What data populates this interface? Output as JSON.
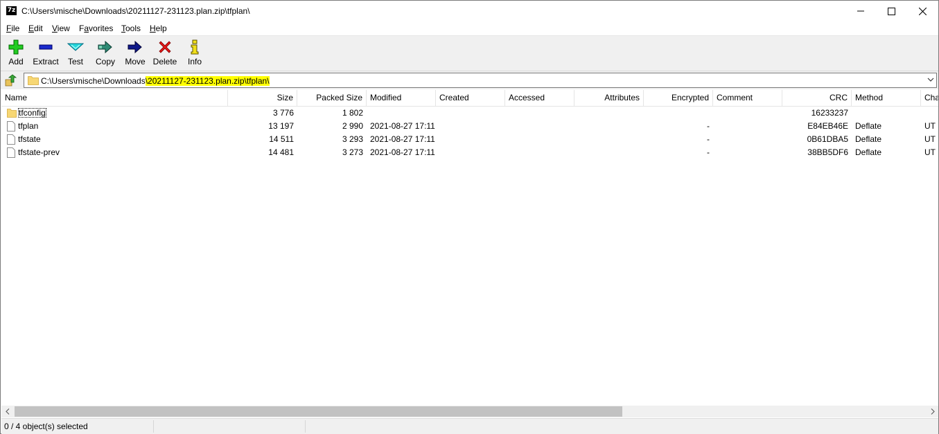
{
  "window": {
    "title": "C:\\Users\\mische\\Downloads\\20211127-231123.plan.zip\\tfplan\\",
    "app_icon_text": "7z"
  },
  "menu": [
    {
      "underline": "F",
      "rest": "ile"
    },
    {
      "underline": "E",
      "rest": "dit"
    },
    {
      "underline": "V",
      "rest": "iew"
    },
    {
      "pre": "F",
      "underline": "a",
      "rest": "vorites"
    },
    {
      "underline": "T",
      "rest": "ools"
    },
    {
      "underline": "H",
      "rest": "elp"
    }
  ],
  "toolbar": {
    "add": "Add",
    "extract": "Extract",
    "test": "Test",
    "copy": "Copy",
    "move": "Move",
    "delete": "Delete",
    "info": "Info"
  },
  "address": {
    "prefix": "C:\\Users\\mische\\Downloads",
    "highlighted": "\\20211127-231123.plan.zip\\tfplan\\",
    "highlight_color": "#ffff00"
  },
  "columns": {
    "name": "Name",
    "size": "Size",
    "packed": "Packed Size",
    "modified": "Modified",
    "created": "Created",
    "accessed": "Accessed",
    "attributes": "Attributes",
    "encrypted": "Encrypted",
    "comment": "Comment",
    "crc": "CRC",
    "method": "Method",
    "characteristics": "Cha"
  },
  "rows": [
    {
      "name": "tfconfig",
      "type": "folder",
      "size": "3 776",
      "packed": "1 802",
      "modified": "",
      "encrypted": "",
      "crc": "16233237",
      "method": "",
      "chars": ""
    },
    {
      "name": "tfplan",
      "type": "file",
      "size": "13 197",
      "packed": "2 990",
      "modified": "2021-08-27 17:11",
      "encrypted": "-",
      "crc": "E84EB46E",
      "method": "Deflate",
      "chars": "UT"
    },
    {
      "name": "tfstate",
      "type": "file",
      "size": "14 511",
      "packed": "3 293",
      "modified": "2021-08-27 17:11",
      "encrypted": "-",
      "crc": "0B61DBA5",
      "method": "Deflate",
      "chars": "UT"
    },
    {
      "name": "tfstate-prev",
      "type": "file",
      "size": "14 481",
      "packed": "3 273",
      "modified": "2021-08-27 17:11",
      "encrypted": "-",
      "crc": "38BB5DF6",
      "method": "Deflate",
      "chars": "UT"
    }
  ],
  "status": {
    "selection": "0 / 4 object(s) selected"
  }
}
